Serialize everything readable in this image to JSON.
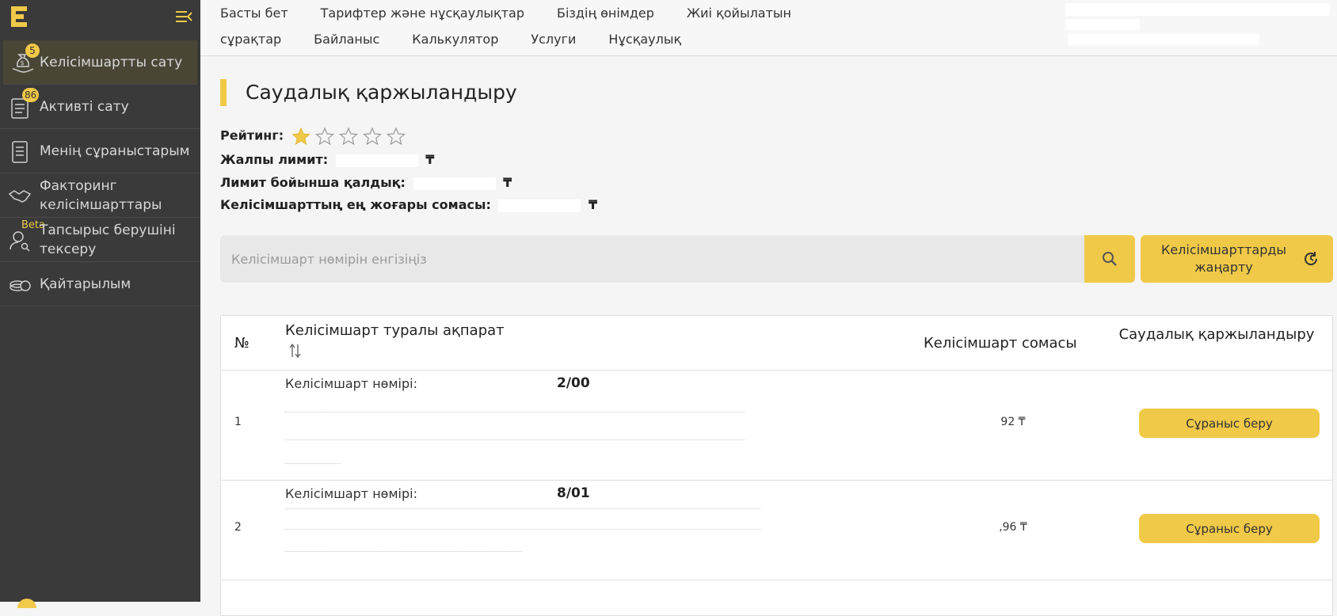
{
  "sidebar": {
    "items": [
      {
        "label": "Келісімшартты сату",
        "badge": "5"
      },
      {
        "label": "Активті сату",
        "badge": "86"
      },
      {
        "label": "Менің сұраныстарым"
      },
      {
        "label": "Факторинг келісімшарттары"
      },
      {
        "label": "Тапсырыс берушіні тексеру",
        "tag": "Beta"
      },
      {
        "label": "Қайтарылым"
      }
    ]
  },
  "topnav": {
    "row1": [
      "Басты бет",
      "Тарифтер және нұсқаулықтар",
      "Біздің өнімдер",
      "Жиі қойылатын"
    ],
    "row2": [
      "сұрақтар",
      "Байланыс",
      "Калькулятор",
      "Услуги",
      "Нұсқаулық"
    ]
  },
  "page": {
    "title": "Саудалық қаржыландыру",
    "rating_label": "Рейтинг:",
    "rating": 1,
    "rating_max": 5,
    "total_limit_label": "Жалпы лимит:",
    "remaining_limit_label": "Лимит бойынша қалдық:",
    "max_contract_label": "Келісімшарттың ең жоғары сомасы:",
    "currency": "₸"
  },
  "search": {
    "placeholder": "Келісімшарт нөмірін енгізіңіз",
    "refresh_label": "Келісімшарттарды жаңарту"
  },
  "table": {
    "headers": {
      "num": "№",
      "info": "Келісімшарт туралы ақпарат",
      "amount": "Келісімшарт сомасы",
      "action": "Саудалық қаржыландыру"
    },
    "rows": [
      {
        "num": "1",
        "contract_label": "Келісімшарт нөмірі:",
        "contract_suffix": "2/00",
        "amount": "92 ₸",
        "action": "Сұраныс беру"
      },
      {
        "num": "2",
        "contract_label": "Келісімшарт нөмірі:",
        "contract_suffix": "8/01",
        "amount": ",96 ₸",
        "action": "Сұраныс беру"
      }
    ]
  },
  "colors": {
    "accent": "#f0c948",
    "sidebar_bg": "#3a3a3a"
  }
}
